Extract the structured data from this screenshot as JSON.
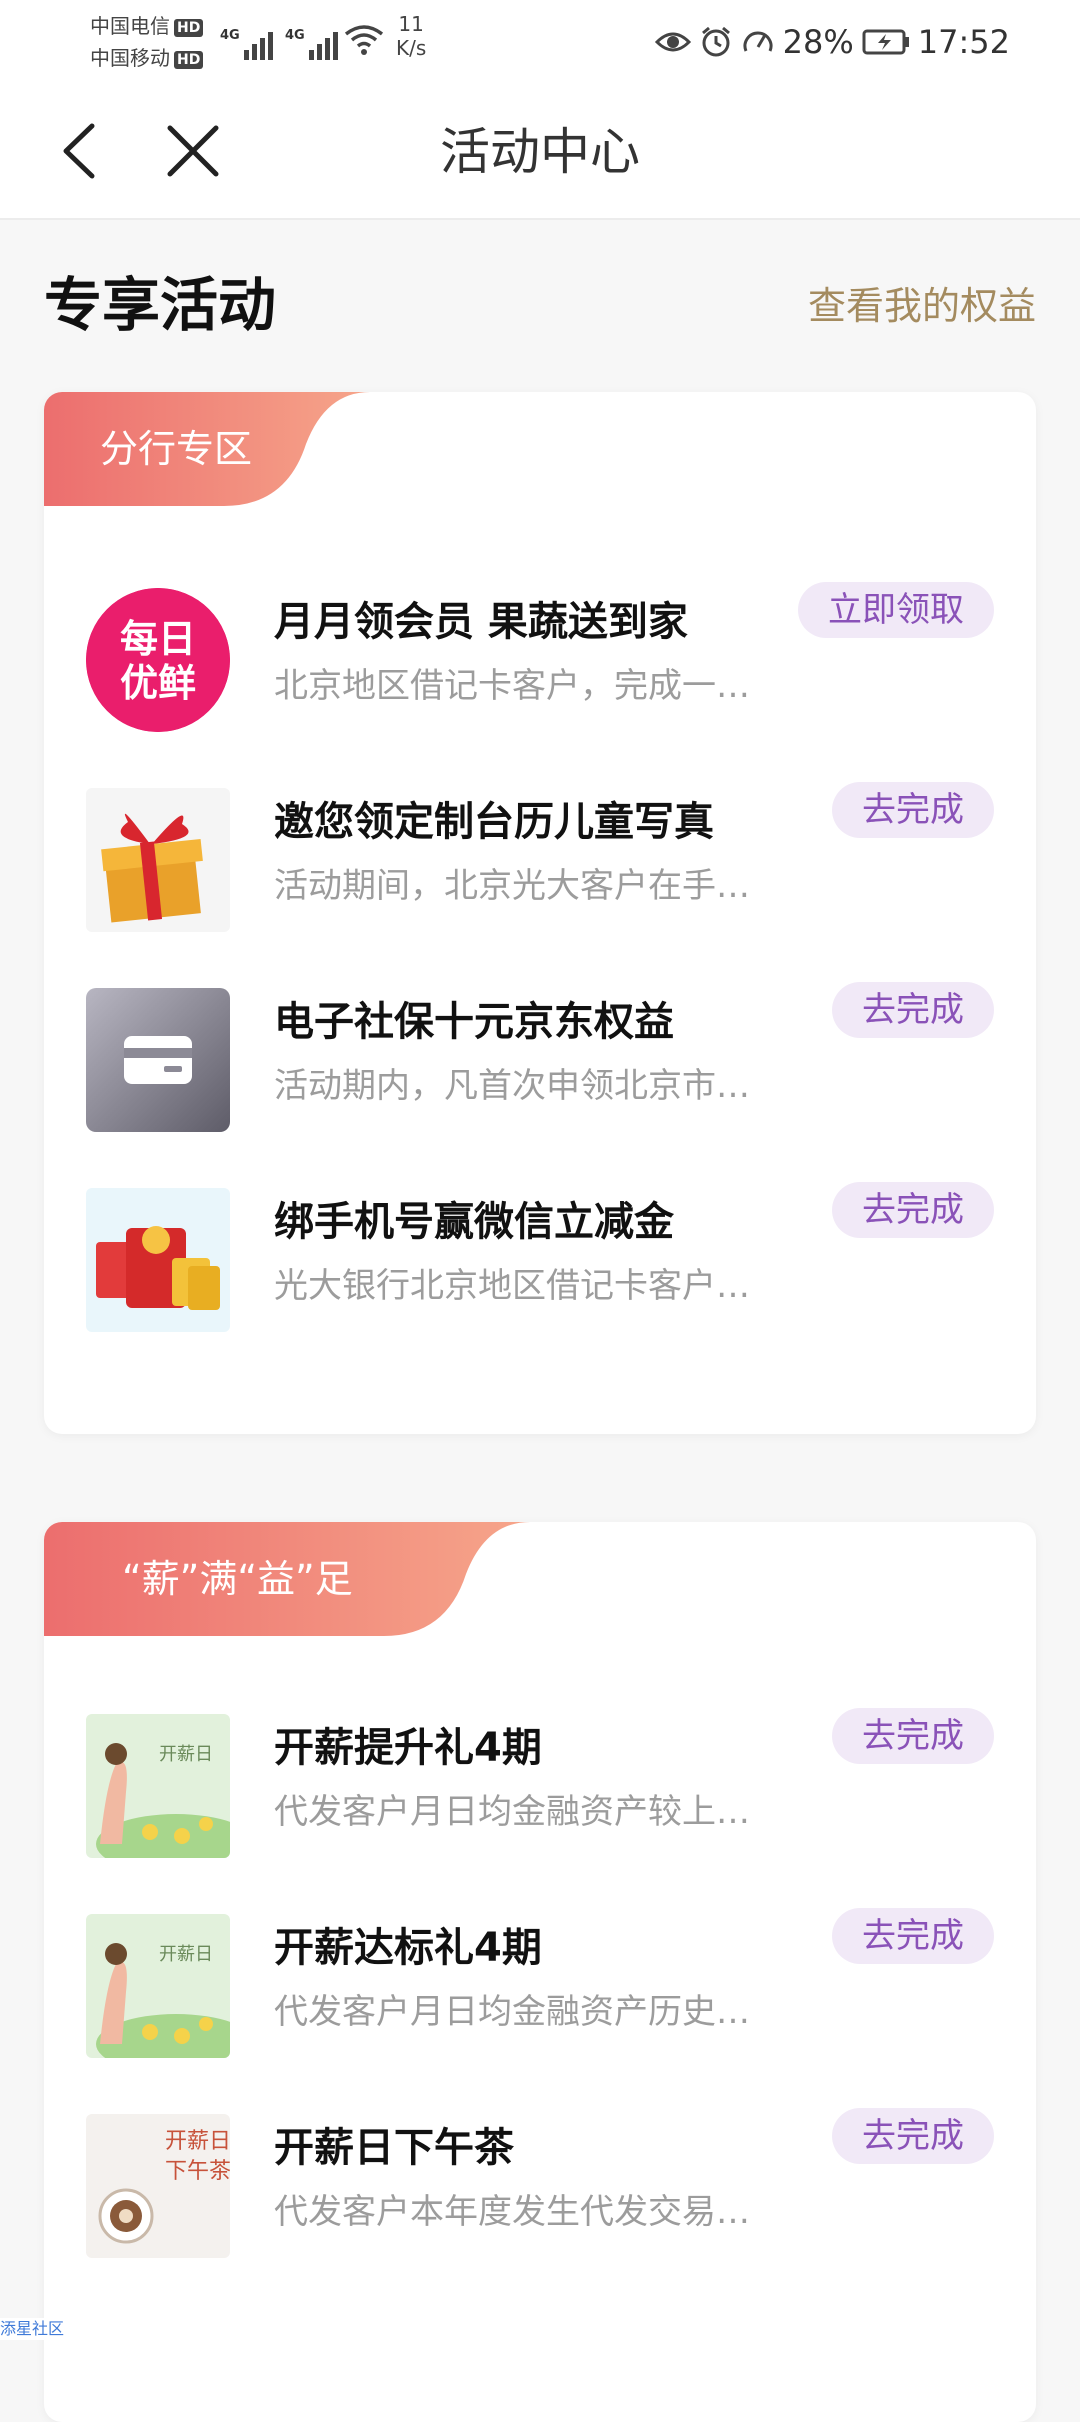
{
  "status_bar": {
    "carrier_1": "中国电信",
    "carrier_2": "中国移动",
    "hd_label": "HD",
    "network_1": "4G",
    "network_2": "4G",
    "speed_value": "11",
    "speed_unit": "K/s",
    "battery": "28%",
    "time": "17:52"
  },
  "nav": {
    "title": "活动中心"
  },
  "section": {
    "title": "专享活动",
    "link": "查看我的权益"
  },
  "cards": [
    {
      "tag": "分行专区",
      "items": [
        {
          "title": "月月领会员 果蔬送到家",
          "desc": "北京地区借记卡客户，完成一…",
          "action": "立即领取",
          "thumb_text_1": "每日",
          "thumb_text_2": "优鲜"
        },
        {
          "title": "邀您领定制台历儿童写真",
          "desc": "活动期间，北京光大客户在手…",
          "action": "去完成"
        },
        {
          "title": "电子社保十元京东权益",
          "desc": "活动期内，凡首次申领北京市…",
          "action": "去完成"
        },
        {
          "title": "绑手机号赢微信立减金",
          "desc": "光大银行北京地区借记卡客户…",
          "action": "去完成"
        }
      ]
    },
    {
      "tag": "“薪”满“益”足",
      "items": [
        {
          "title": "开薪提升礼4期",
          "desc": "代发客户月日均金融资产较上…",
          "action": "去完成",
          "thumb_text_1": "开薪日"
        },
        {
          "title": "开薪达标礼4期",
          "desc": "代发客户月日均金融资产历史…",
          "action": "去完成",
          "thumb_text_1": "开薪日"
        },
        {
          "title": "开薪日下午茶",
          "desc": "代发客户本年度发生代发交易…",
          "action": "去完成",
          "thumb_text_1": "开薪日",
          "thumb_text_2": "下午茶"
        }
      ]
    }
  ],
  "footer": {
    "tiny_text": "添星社区"
  },
  "colors": {
    "accent_purple": "#8a52b8",
    "tag_gradient_start": "#ec6e6e",
    "tag_gradient_end": "#f6a58a",
    "link_gold": "#a48b5f"
  }
}
